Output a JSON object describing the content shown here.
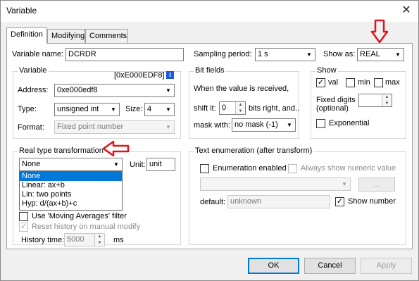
{
  "window": {
    "title": "Variable",
    "close_glyph": "✕"
  },
  "tabs": [
    {
      "label": "Definition",
      "active": true
    },
    {
      "label": "Modifying",
      "active": false
    },
    {
      "label": "Comments",
      "active": false
    }
  ],
  "top": {
    "name_label": "Variable name:",
    "name_value": "DCRDR",
    "sampling_label": "Sampling period:",
    "sampling_value": "1 s",
    "show_as_label": "Show as:",
    "show_as_value": "REAL"
  },
  "variable_group": {
    "title": "Variable",
    "hex_address": "[0xE000EDF8]",
    "info_glyph": "i",
    "address_label": "Address:",
    "address_value": "0xe000edf8",
    "type_label": "Type:",
    "type_value": "unsigned int",
    "size_label": "Size:",
    "size_value": "4",
    "format_label": "Format:",
    "format_value": "Fixed point number"
  },
  "bitfields_group": {
    "title": "Bit fields",
    "when_text": "When the value is received,",
    "shift_label": "shift it:",
    "shift_value": "0",
    "bits_right_text": "bits right, and..",
    "mask_label": "mask with:",
    "mask_value": "no mask (-1)"
  },
  "show_group": {
    "title": "Show",
    "val_label": "val",
    "val_checked": true,
    "min_label": "min",
    "min_checked": false,
    "max_label": "max",
    "max_checked": false,
    "fixed_digits_label_1": "Fixed digits",
    "fixed_digits_label_2": "(optional)",
    "fixed_digits_value": "",
    "exponential_label": "Exponential",
    "exponential_checked": false
  },
  "real_type_group": {
    "title": "Real type transformation",
    "selected": "None",
    "unit_label": "Unit:",
    "unit_value": "unit",
    "options": [
      "None",
      "Linear: ax+b",
      "Lin: two points",
      "Hyp:  d/(ax+b)+c"
    ],
    "moving_avg_label": "Use 'Moving Averages' filter",
    "reset_history_label": "Reset history on manual modify",
    "history_time_label": "History time:",
    "history_time_value": "5000",
    "history_time_unit": "ms"
  },
  "text_enum_group": {
    "title": "Text enumeration (after transform)",
    "enum_enabled_label": "Enumeration enabled",
    "always_numeric_label": "Always show numeric value",
    "combo_value": "",
    "ellipsis_label": "...",
    "default_label": "default:",
    "default_value": "unknown",
    "show_number_label": "Show number",
    "show_number_checked": true
  },
  "buttons": {
    "ok": "OK",
    "cancel": "Cancel",
    "apply": "Apply"
  },
  "colors": {
    "accent": "#0078d7",
    "annotation_arrow": "#e0141b"
  }
}
